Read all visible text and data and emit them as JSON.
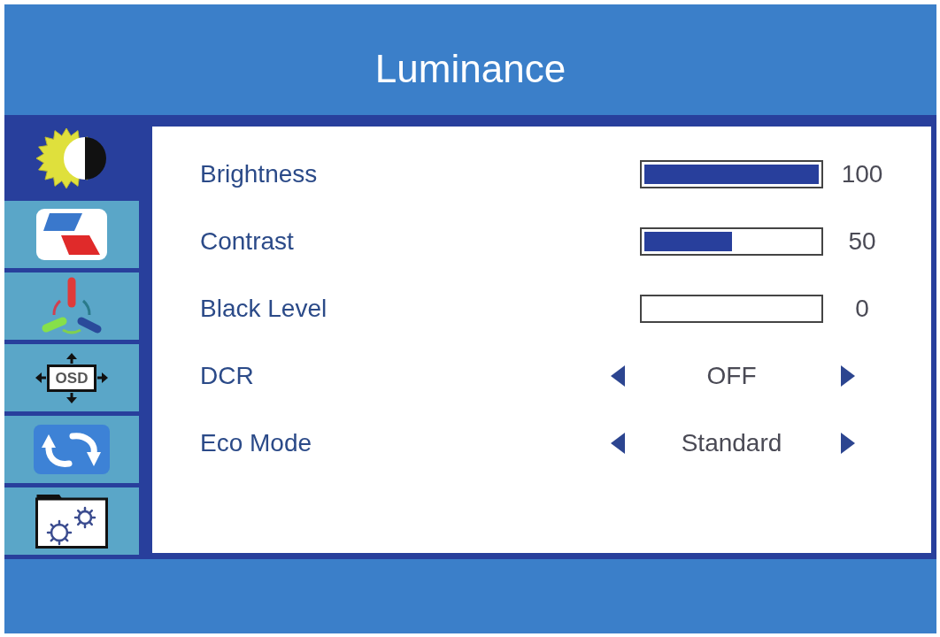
{
  "title": "Luminance",
  "sidebar": {
    "items": [
      {
        "kind": "sun",
        "selected": true
      },
      {
        "kind": "shapes",
        "selected": false
      },
      {
        "kind": "tricolor",
        "selected": false
      },
      {
        "kind": "osd",
        "label": "OSD",
        "selected": false
      },
      {
        "kind": "cycle",
        "selected": false
      },
      {
        "kind": "folder",
        "selected": false
      }
    ]
  },
  "settings": [
    {
      "kind": "slider",
      "label": "Brightness",
      "level": 1,
      "reading": "100"
    },
    {
      "kind": "slider",
      "label": "Contrast",
      "level": 0.5,
      "reading": "50"
    },
    {
      "kind": "slider",
      "label": "Black Level",
      "level": 0,
      "reading": "0"
    },
    {
      "kind": "choice",
      "label": "DCR",
      "value": "OFF"
    },
    {
      "kind": "choice",
      "label": "Eco Mode",
      "value": "Standard"
    }
  ]
}
